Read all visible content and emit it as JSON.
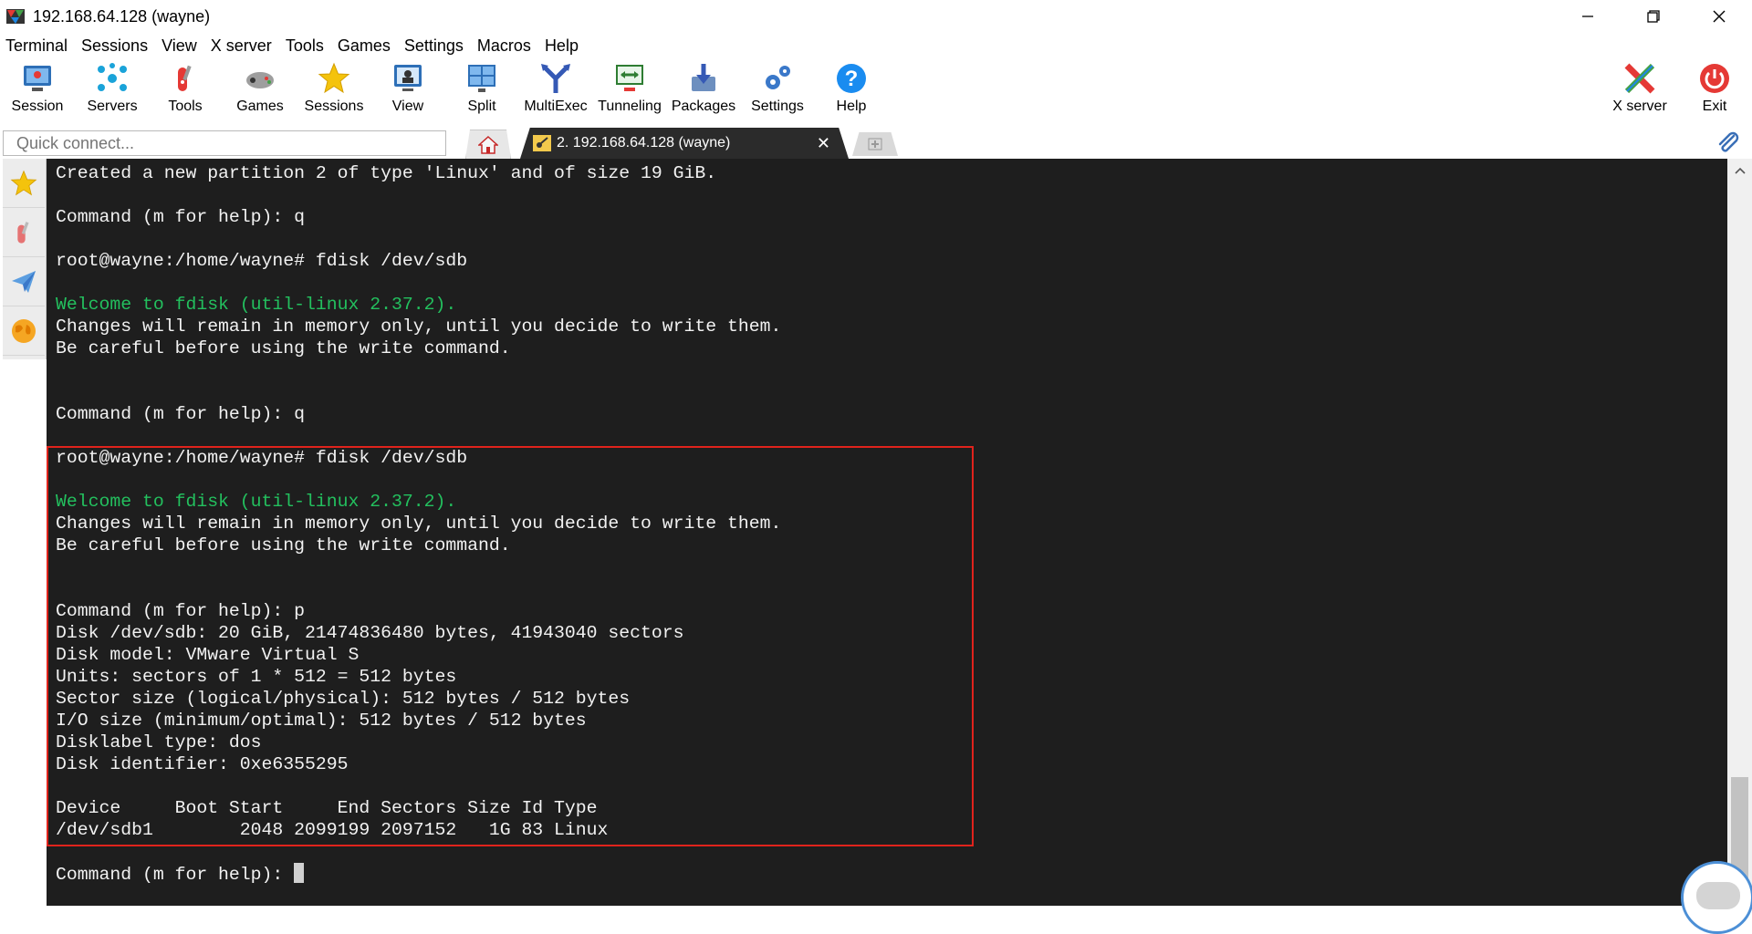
{
  "window": {
    "title": "192.168.64.128 (wayne)"
  },
  "menu": [
    "Terminal",
    "Sessions",
    "View",
    "X server",
    "Tools",
    "Games",
    "Settings",
    "Macros",
    "Help"
  ],
  "toolbar": {
    "session": "Session",
    "servers": "Servers",
    "tools": "Tools",
    "games": "Games",
    "sessions": "Sessions",
    "view": "View",
    "split": "Split",
    "multiexec": "MultiExec",
    "tunneling": "Tunneling",
    "packages": "Packages",
    "settings": "Settings",
    "help": "Help",
    "xserver": "X server",
    "exit": "Exit"
  },
  "tabs": {
    "quick_connect_placeholder": "Quick connect...",
    "session_tab_label": "2. 192.168.64.128 (wayne)",
    "close_symbol": "✕"
  },
  "terminal": {
    "lines": [
      {
        "text": "Created a new partition 2 of type 'Linux' and of size 19 GiB.",
        "color": "white"
      },
      {
        "text": "",
        "color": "white"
      },
      {
        "text": "Command (m for help): q",
        "color": "white"
      },
      {
        "text": "",
        "color": "white"
      },
      {
        "text": "root@wayne:/home/wayne# fdisk /dev/sdb",
        "color": "white"
      },
      {
        "text": "",
        "color": "white"
      },
      {
        "text": "Welcome to fdisk (util-linux 2.37.2).",
        "color": "green"
      },
      {
        "text": "Changes will remain in memory only, until you decide to write them.",
        "color": "white"
      },
      {
        "text": "Be careful before using the write command.",
        "color": "white"
      },
      {
        "text": "",
        "color": "white"
      },
      {
        "text": "",
        "color": "white"
      },
      {
        "text": "Command (m for help): q",
        "color": "white"
      },
      {
        "text": "",
        "color": "white"
      },
      {
        "text": "root@wayne:/home/wayne# fdisk /dev/sdb",
        "color": "white"
      },
      {
        "text": "",
        "color": "white"
      },
      {
        "text": "Welcome to fdisk (util-linux 2.37.2).",
        "color": "green"
      },
      {
        "text": "Changes will remain in memory only, until you decide to write them.",
        "color": "white"
      },
      {
        "text": "Be careful before using the write command.",
        "color": "white"
      },
      {
        "text": "",
        "color": "white"
      },
      {
        "text": "",
        "color": "white"
      },
      {
        "text": "Command (m for help): p",
        "color": "white"
      },
      {
        "text": "Disk /dev/sdb: 20 GiB, 21474836480 bytes, 41943040 sectors",
        "color": "white"
      },
      {
        "text": "Disk model: VMware Virtual S",
        "color": "white"
      },
      {
        "text": "Units: sectors of 1 * 512 = 512 bytes",
        "color": "white"
      },
      {
        "text": "Sector size (logical/physical): 512 bytes / 512 bytes",
        "color": "white"
      },
      {
        "text": "I/O size (minimum/optimal): 512 bytes / 512 bytes",
        "color": "white"
      },
      {
        "text": "Disklabel type: dos",
        "color": "white"
      },
      {
        "text": "Disk identifier: 0xe6355295",
        "color": "white"
      },
      {
        "text": "",
        "color": "white"
      },
      {
        "text": "Device     Boot Start     End Sectors Size Id Type",
        "color": "white"
      },
      {
        "text": "/dev/sdb1        2048 2099199 2097152   1G 83 Linux",
        "color": "white"
      },
      {
        "text": "",
        "color": "white"
      }
    ],
    "prompt": "Command (m for help): "
  },
  "colors": {
    "terminal_bg": "#1e1e1e",
    "green_text": "#23c05e",
    "highlight": "#e0231c"
  }
}
